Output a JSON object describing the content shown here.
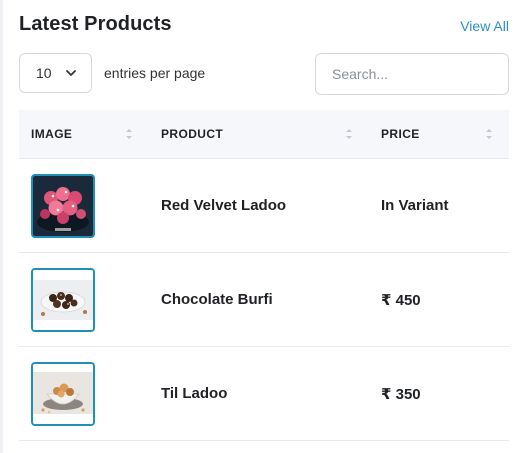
{
  "card": {
    "title": "Latest Products",
    "view_all": "View All"
  },
  "controls": {
    "page_size": "10",
    "entries_label": "entries per page",
    "search_placeholder": "Search..."
  },
  "table": {
    "columns": [
      "IMAGE",
      "PRODUCT",
      "PRICE"
    ],
    "rows": [
      {
        "image": "red-velvet-ladoo-photo",
        "product": "Red Velvet Ladoo",
        "price": "In Variant"
      },
      {
        "image": "chocolate-burfi-photo",
        "product": "Chocolate Burfi",
        "price": "₹ 450"
      },
      {
        "image": "til-ladoo-photo",
        "product": "Til Ladoo",
        "price": "₹ 350"
      }
    ]
  },
  "colors": {
    "accent": "#2a8fc1",
    "thumb_border": "#1f8fb8",
    "header_bg": "#f5f7fa"
  }
}
